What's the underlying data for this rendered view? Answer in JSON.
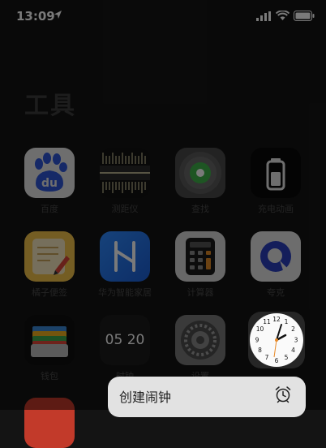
{
  "status_bar": {
    "time": "13:09"
  },
  "folder": {
    "title": "工具"
  },
  "apps": [
    {
      "label": "百度"
    },
    {
      "label": "测距仪"
    },
    {
      "label": "查找"
    },
    {
      "label": "充电动画"
    },
    {
      "label": "橘子便签"
    },
    {
      "label": "华为智能家居"
    },
    {
      "label": "计算器"
    },
    {
      "label": "夸克"
    },
    {
      "label": "钱包"
    },
    {
      "label": "时钟",
      "widget_text": "05 20"
    },
    {
      "label": "设置"
    },
    {
      "label": ""
    }
  ],
  "baidu_logo_text": "du",
  "quick_action": {
    "label": "创建闹钟",
    "icon": "alarm-clock-icon"
  },
  "colors": {
    "quick_action_bg": "#e2e2e2",
    "background": "#141414"
  }
}
